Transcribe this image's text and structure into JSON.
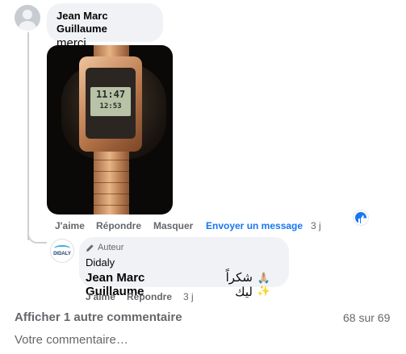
{
  "comment1": {
    "author": "Jean Marc Guillaume",
    "text": "merci",
    "photo_lcd_time": "11:47",
    "photo_lcd_small": "12:53",
    "actions": {
      "like": "J'aime",
      "reply": "Répondre",
      "hide": "Masquer",
      "message": "Envoyer un message",
      "time": "3 j"
    },
    "reaction_icon": "like-icon"
  },
  "reply": {
    "badge": "Auteur",
    "badge_icon": "pen-icon",
    "author": "Didaly",
    "avatar_logo": "DIDALY",
    "mention": "Jean Marc Guillaume",
    "text": "شكراً ليك",
    "emoji": "🙏🏼✨",
    "actions": {
      "like": "J'aime",
      "reply": "Répondre",
      "time": "3 j"
    }
  },
  "footer": {
    "more_comments": "Afficher 1 autre commentaire",
    "count": "68 sur 69",
    "input_placeholder": "Votre commentaire…"
  },
  "colors": {
    "bubble": "#f0f2f5",
    "link_blue": "#1877f2",
    "secondary_text": "#65676b"
  }
}
